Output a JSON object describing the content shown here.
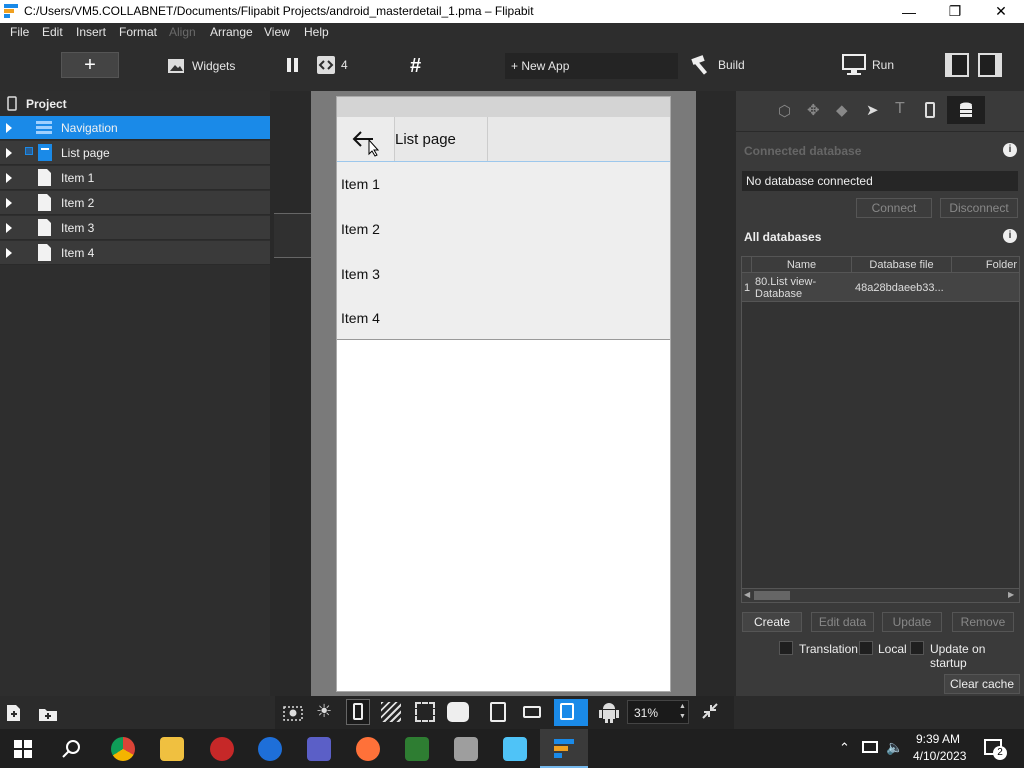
{
  "window": {
    "title": "C:/Users/VM5.COLLABNET/Documents/Flipabit Projects/android_masterdetail_1.pma – Flipabit"
  },
  "menu": [
    "File",
    "Edit",
    "Insert",
    "Format",
    "Align",
    "Arrange",
    "View",
    "Help"
  ],
  "toolbar": {
    "widgets_label": "Widgets",
    "page_count": "4",
    "new_app_label": "+ New App",
    "build_label": "Build",
    "run_label": "Run"
  },
  "project": {
    "title": "Project",
    "items": [
      {
        "label": "Navigation"
      },
      {
        "label": "List page"
      },
      {
        "label": "Item 1"
      },
      {
        "label": "Item 2"
      },
      {
        "label": "Item 3"
      },
      {
        "label": "Item 4"
      }
    ]
  },
  "phone": {
    "header_title": "List page",
    "items": [
      "Item 1",
      "Item 2",
      "Item 3",
      "Item 4"
    ]
  },
  "database": {
    "connected_title": "Connected database",
    "connected_value": "No database connected",
    "connect_label": "Connect",
    "disconnect_label": "Disconnect",
    "all_title": "All databases",
    "columns": [
      "Name",
      "Database file",
      "Folder"
    ],
    "rows": [
      {
        "index": "1",
        "name": "80.List view-Database",
        "file": "48a28bdaeeb33..."
      }
    ],
    "actions": {
      "create": "Create",
      "edit": "Edit data",
      "update": "Update",
      "remove": "Remove"
    },
    "checks": {
      "translation": "Translation",
      "local": "Local",
      "update_on_startup": "Update on startup"
    },
    "clear_cache": "Clear cache"
  },
  "zoom": "31%",
  "taskbar": {
    "time": "9:39 AM",
    "date": "4/10/2023",
    "notif": "2"
  },
  "colors": {
    "accent": "#1a8ae8",
    "panel": "#3a3a3a"
  }
}
